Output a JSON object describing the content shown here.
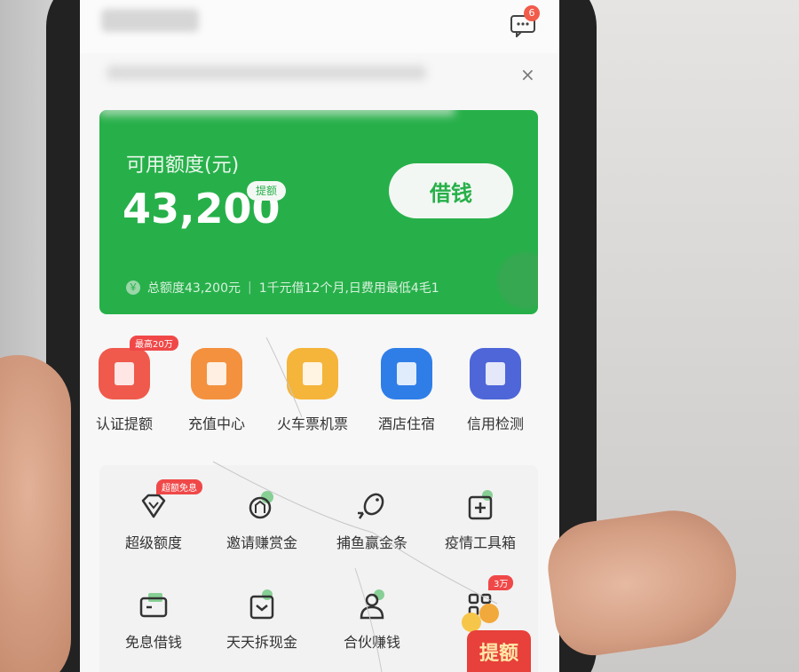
{
  "topbar": {
    "message_badge": "6"
  },
  "notice": {
    "close_label": "×"
  },
  "credit": {
    "available_label": "可用额度(元)",
    "amount": "43,200",
    "raise_tag": "提额",
    "borrow_button": "借钱",
    "coin_symbol": "￥",
    "total_limit": "总额度43,200元",
    "separator": "|",
    "promo_text": "1千元借12个月,日费用最低4毛1"
  },
  "services": [
    {
      "label": "认证提额",
      "color": "#ef5a4d",
      "tag": "最高20万"
    },
    {
      "label": "充值中心",
      "color": "#f3913f",
      "tag": ""
    },
    {
      "label": "火车票机票",
      "color": "#f5b43a",
      "tag": ""
    },
    {
      "label": "酒店住宿",
      "color": "#2f7ee8",
      "tag": ""
    },
    {
      "label": "信用检测",
      "color": "#4e66d8",
      "tag": ""
    }
  ],
  "tools": [
    {
      "label": "超级额度",
      "icon": "diamond-icon",
      "tag": "超额免息"
    },
    {
      "label": "邀请赚赏金",
      "icon": "invite-icon",
      "tag": ""
    },
    {
      "label": "捕鱼赢金条",
      "icon": "fish-icon",
      "tag": ""
    },
    {
      "label": "疫情工具箱",
      "icon": "medkit-icon",
      "tag": ""
    },
    {
      "label": "免息借钱",
      "icon": "card-icon",
      "tag": ""
    },
    {
      "label": "天天拆现金",
      "icon": "cash-box-icon",
      "tag": ""
    },
    {
      "label": "合伙赚钱",
      "icon": "partner-icon",
      "tag": ""
    },
    {
      "label": "",
      "icon": "grid-apps-icon",
      "tag": "3万"
    }
  ],
  "promo": {
    "label": "提额"
  },
  "colors": {
    "brand_green": "#27b04a",
    "badge_red": "#f25a4a"
  }
}
